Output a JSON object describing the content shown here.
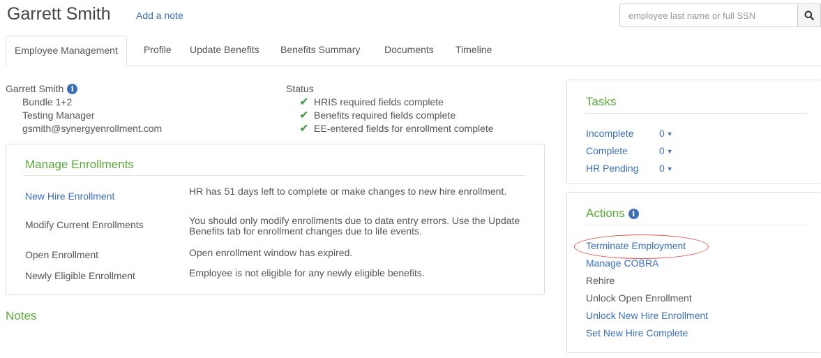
{
  "header": {
    "employee_name": "Garrett Smith",
    "add_note": "Add a note",
    "search_placeholder": "employee last name or full SSN"
  },
  "tabs": [
    {
      "label": "Employee Management",
      "active": true
    },
    {
      "label": "Profile"
    },
    {
      "label": "Update Benefits"
    },
    {
      "label": "Benefits Summary"
    },
    {
      "label": "Documents"
    },
    {
      "label": "Timeline"
    }
  ],
  "employee": {
    "name": "Garrett Smith",
    "lines": [
      "Bundle 1+2",
      "Testing Manager",
      "gsmith@synergyenrollment.com"
    ]
  },
  "status": {
    "title": "Status",
    "items": [
      "HRIS required fields complete",
      "Benefits required fields complete",
      "EE-entered fields for enrollment complete"
    ]
  },
  "manage": {
    "title": "Manage Enrollments",
    "rows": [
      {
        "label": "New Hire Enrollment",
        "desc": "HR has 51 days left to complete or make changes to new hire enrollment.",
        "link": true
      },
      {
        "label": "Modify Current Enrollments",
        "desc": "You should only modify enrollments due to data entry errors. Use the Update Benefits tab for enrollment changes due to life events.",
        "link": false
      },
      {
        "label": "Open Enrollment",
        "desc": "Open enrollment window has expired.",
        "link": false
      },
      {
        "label": "Newly Eligible Enrollment",
        "desc": "Employee is not eligible for any newly eligible benefits.",
        "link": false
      }
    ]
  },
  "notes": {
    "title": "Notes"
  },
  "tasks": {
    "title": "Tasks",
    "items": [
      {
        "label": "Incomplete",
        "count": "0"
      },
      {
        "label": "Complete",
        "count": "0"
      },
      {
        "label": "HR Pending",
        "count": "0"
      }
    ]
  },
  "actions": {
    "title": "Actions",
    "items": [
      {
        "label": "Terminate Employment",
        "link": true
      },
      {
        "label": "Manage COBRA",
        "link": true
      },
      {
        "label": "Rehire",
        "link": false
      },
      {
        "label": "Unlock Open Enrollment",
        "link": false
      },
      {
        "label": "Unlock New Hire Enrollment",
        "link": true
      },
      {
        "label": "Set New Hire Complete",
        "link": true
      }
    ]
  },
  "colors": {
    "link": "#3a6fb3",
    "accent_green": "#5aa83a",
    "check_green": "#3c9a3c",
    "highlight_circle": "#d9534f"
  }
}
